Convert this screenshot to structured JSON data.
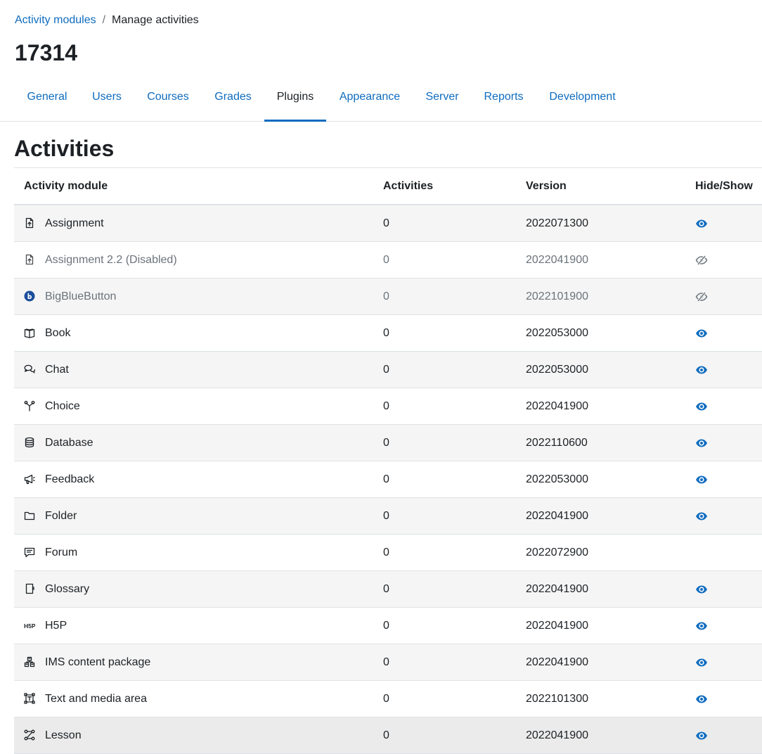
{
  "breadcrumb": {
    "link": "Activity modules",
    "separator": "/",
    "current": "Manage activities"
  },
  "page_title": "17314",
  "tabs": [
    "General",
    "Users",
    "Courses",
    "Grades",
    "Plugins",
    "Appearance",
    "Server",
    "Reports",
    "Development"
  ],
  "active_tab": "Plugins",
  "section_title": "Activities",
  "table": {
    "headers": {
      "module": "Activity module",
      "activities": "Activities",
      "version": "Version",
      "hideshow": "Hide/Show"
    },
    "rows": [
      {
        "icon": "assignment-icon",
        "name": "Assignment",
        "count": "0",
        "version": "2022071300",
        "visibility": "visible"
      },
      {
        "icon": "assignment-icon",
        "name": "Assignment 2.2 (Disabled)",
        "count": "0",
        "version": "2022041900",
        "visibility": "hidden"
      },
      {
        "icon": "bigbluebutton-icon",
        "name": "BigBlueButton",
        "count": "0",
        "version": "2022101900",
        "visibility": "hidden"
      },
      {
        "icon": "book-icon",
        "name": "Book",
        "count": "0",
        "version": "2022053000",
        "visibility": "visible"
      },
      {
        "icon": "chat-icon",
        "name": "Chat",
        "count": "0",
        "version": "2022053000",
        "visibility": "visible"
      },
      {
        "icon": "choice-icon",
        "name": "Choice",
        "count": "0",
        "version": "2022041900",
        "visibility": "visible"
      },
      {
        "icon": "database-icon",
        "name": "Database",
        "count": "0",
        "version": "2022110600",
        "visibility": "visible"
      },
      {
        "icon": "feedback-icon",
        "name": "Feedback",
        "count": "0",
        "version": "2022053000",
        "visibility": "visible"
      },
      {
        "icon": "folder-icon",
        "name": "Folder",
        "count": "0",
        "version": "2022041900",
        "visibility": "visible"
      },
      {
        "icon": "forum-icon",
        "name": "Forum",
        "count": "0",
        "version": "2022072900",
        "visibility": "none"
      },
      {
        "icon": "glossary-icon",
        "name": "Glossary",
        "count": "0",
        "version": "2022041900",
        "visibility": "visible"
      },
      {
        "icon": "h5p-icon",
        "name": "H5P",
        "count": "0",
        "version": "2022041900",
        "visibility": "visible"
      },
      {
        "icon": "ims-package-icon",
        "name": "IMS content package",
        "count": "0",
        "version": "2022041900",
        "visibility": "visible"
      },
      {
        "icon": "text-media-icon",
        "name": "Text and media area",
        "count": "0",
        "version": "2022101300",
        "visibility": "visible"
      },
      {
        "icon": "lesson-icon",
        "name": "Lesson",
        "count": "0",
        "version": "2022041900",
        "visibility": "visible"
      }
    ]
  },
  "colors": {
    "link": "#0f6cbf",
    "muted": "#6a737b",
    "bbb_brand": "#1b4e9b"
  }
}
